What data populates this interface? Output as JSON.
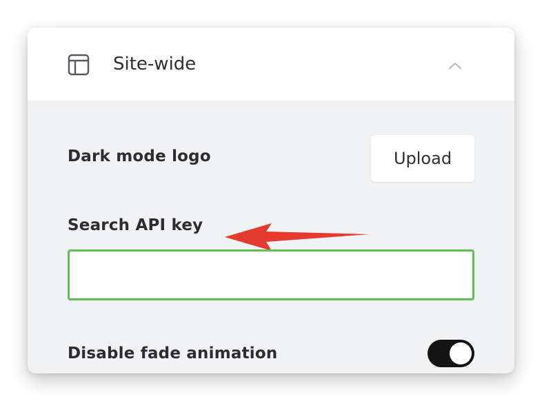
{
  "section": {
    "title": "Site-wide",
    "icon": "layout-icon",
    "collapse_icon": "chevron-up-icon",
    "expanded": true
  },
  "dark_mode_logo": {
    "label": "Dark mode logo",
    "button_label": "Upload"
  },
  "search_api_key": {
    "label": "Search API key",
    "value": "",
    "placeholder": ""
  },
  "annotation": {
    "icon": "red-arrow-icon",
    "color": "#e53a2e"
  },
  "disable_fade_animation": {
    "label": "Disable fade animation",
    "enabled": true
  },
  "colors": {
    "input_focus_border": "#5ec14f",
    "toggle_on": "#141414",
    "panel_background": "#f1f2f4"
  }
}
